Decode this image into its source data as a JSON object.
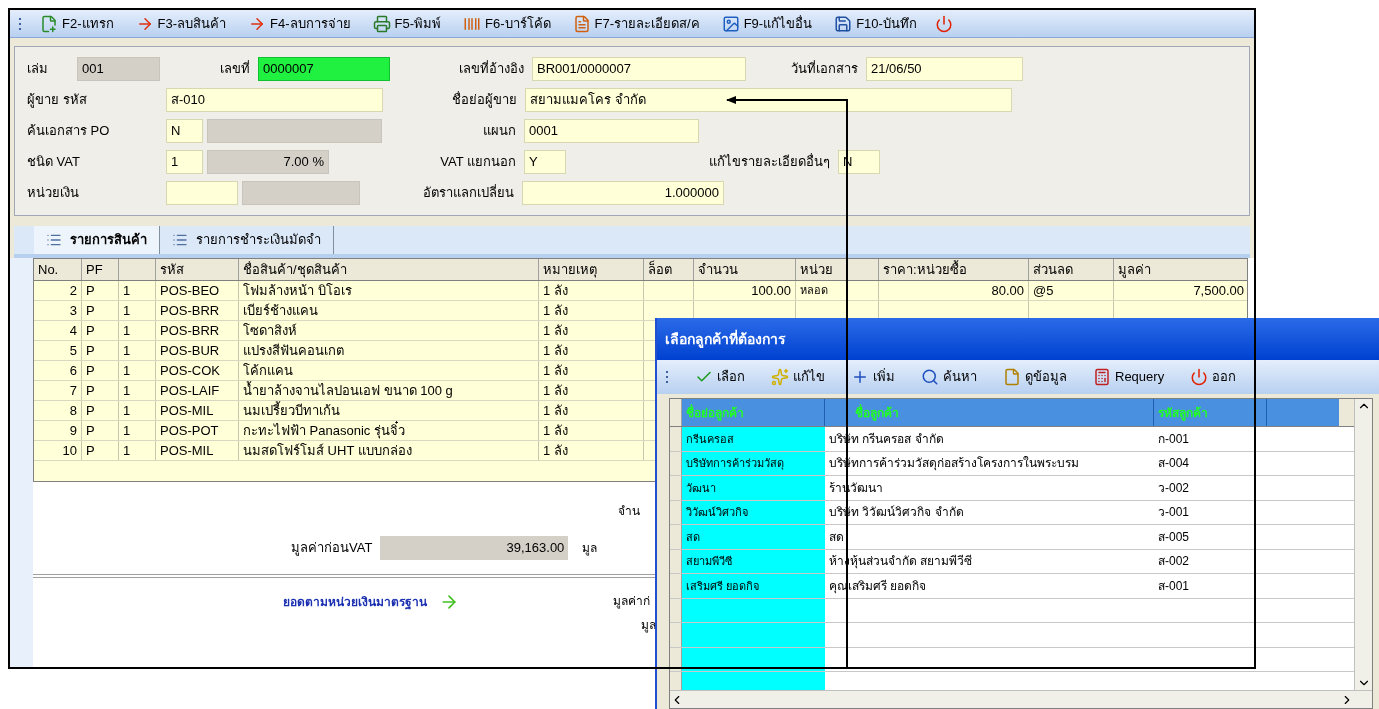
{
  "toolbar": [
    {
      "label": "F2-แทรก"
    },
    {
      "label": "F3-ลบสินค้า"
    },
    {
      "label": "F4-ลบการจ่าย"
    },
    {
      "label": "F5-พิมพ์"
    },
    {
      "label": "F6-บาร์โค้ด"
    },
    {
      "label": "F7-รายละเอียดส/ค"
    },
    {
      "label": "F9-แก้ไขอื่น"
    },
    {
      "label": "F10-บันทึก"
    }
  ],
  "form": {
    "fields": [
      {
        "label": "เล่ม",
        "boxes": [
          {
            "kind": "readonly",
            "text": "001"
          }
        ]
      },
      {
        "label": "เลขที่",
        "boxes": [
          {
            "kind": "highlight",
            "text": "0000007"
          }
        ]
      },
      {
        "label": "เลขที่อ้างอิง",
        "boxes": [
          {
            "kind": "input",
            "text": "BR001/0000007"
          }
        ]
      },
      {
        "label": "วันที่เอกสาร",
        "boxes": [
          {
            "kind": "input",
            "text": "21/06/50"
          }
        ]
      },
      {
        "label": "ผู้ขาย รหัส",
        "boxes": [
          {
            "kind": "input",
            "text": "ส-010"
          }
        ]
      },
      {
        "label": "ชื่อย่อผู้ขาย",
        "boxes": [
          {
            "kind": "input",
            "text": "สยามแมคโคร จำกัด"
          }
        ]
      },
      {
        "label": "ค้นเอกสาร PO",
        "boxes": [
          {
            "kind": "input",
            "text": "N"
          },
          {
            "kind": "readonly"
          }
        ]
      },
      {
        "label": "แผนก",
        "boxes": [
          {
            "kind": "input",
            "text": "0001"
          }
        ]
      },
      {
        "label": "ชนิด VAT",
        "boxes": [
          {
            "kind": "input",
            "text": "1"
          },
          {
            "kind": "readonly",
            "text": "7.00 %"
          }
        ]
      },
      {
        "label": "VAT แยกนอก",
        "boxes": [
          {
            "kind": "input",
            "text": "Y"
          }
        ]
      },
      {
        "label": "แก้ไขรายละเอียดอื่นๆ",
        "boxes": [
          {
            "kind": "input",
            "text": "N"
          }
        ]
      },
      {
        "label": "หน่วยเงิน",
        "boxes": [
          {
            "kind": "input"
          },
          {
            "kind": "readonly"
          }
        ]
      },
      {
        "label": "อัตราแลกเปลี่ยน",
        "boxes": [
          {
            "kind": "input",
            "text": "1.000000"
          }
        ]
      }
    ]
  },
  "tabs": [
    {
      "label": "รายการสินค้า",
      "selected": true
    },
    {
      "label": "รายการชำระเงินมัดจำ",
      "selected": false
    }
  ],
  "table": {
    "columns": [
      {
        "label": "No."
      },
      {
        "label": "PF"
      },
      {},
      {
        "label": "รหัส"
      },
      {
        "label": "ชื่อสินค้า/ชุดสินค้า"
      },
      {
        "label": "หมายเหตุ"
      },
      {
        "label": "ล็อต"
      },
      {
        "label": "จำนวน"
      },
      {
        "label": "หน่วย"
      },
      {
        "label": "ราคา:หน่วยซื้อ"
      },
      {
        "label": "ส่วนลด"
      },
      {
        "label": "มูลค่า"
      }
    ],
    "rows": [
      [
        "2",
        "P",
        "1",
        "POS-BEO",
        "โฟมล้างหน้า บิโอเร",
        "1 ลัง",
        null,
        "100.00",
        "หลอด",
        "80.00",
        "@5",
        "7,500.00"
      ],
      [
        "3",
        "P",
        "1",
        "POS-BRR",
        "เบียร์ช้างแคน",
        "1 ลัง"
      ],
      [
        "4",
        "P",
        "1",
        "POS-BRR",
        "โซดาสิงห์",
        "1 ลัง"
      ],
      [
        "5",
        "P",
        "1",
        "POS-BUR",
        "แปรงสีฟันคอนเกต",
        "1 ลัง"
      ],
      [
        "6",
        "P",
        "1",
        "POS-COK",
        "โค้กแคน",
        "1 ลัง"
      ],
      [
        "7",
        "P",
        "1",
        "POS-LAIF",
        "น้ำยาล้างจานไลปอนเอฟ ขนาด 100 g",
        "1 ลัง"
      ],
      [
        "8",
        "P",
        "1",
        "POS-MIL",
        "นมเปรี้ยวบีทาเก้น",
        "1 ลัง"
      ],
      [
        "9",
        "P",
        "1",
        "POS-POT",
        "กะทะไฟฟ้า  Panasonic  รุ่นจิ๋ว",
        "1 ลัง"
      ],
      [
        "10",
        "P",
        "1",
        "POS-MIL",
        "นมสดโฟร์โมส์ UHT แบบกล่อง",
        "1 ลัง"
      ]
    ]
  },
  "totals": {
    "quantity_label": "จำน",
    "pre_vat_label": "มูลค่าก่อนVAT",
    "pre_vat_value": "39,163.00",
    "column_3_label": "มูล"
  },
  "standard_currency": {
    "label": "ยอดตามหน่วยเงินมาตรฐาน",
    "label_2": "มูลค่าก่",
    "label_3": "มูล"
  },
  "dialog": {
    "title": "เลือกลูกค้าที่ต้องการ",
    "toolbar": [
      {
        "label": "เลือก"
      },
      {
        "label": "แก้ไข"
      },
      {
        "label": "เพิ่ม"
      },
      {
        "label": "ค้นหา"
      },
      {
        "label": "ดูข้อมูล"
      },
      {
        "label": "Requery"
      },
      {
        "label": "ออก"
      }
    ],
    "columns": [
      "ชื่อย่อลูกค้า",
      "ชื่อลูกค้า",
      "รหัสลูกค้า"
    ],
    "rows": [
      [
        "กรีนครอส",
        "บริษัท กรีนครอส จำกัด",
        "ก-001"
      ],
      [
        "บริษัทการค้าร่วมวัสดุ",
        "บริษัทการค้าร่วมวัสดุก่อสร้างโครงการในพระบรม",
        "ส-004"
      ],
      [
        "วัฒนา",
        "ร้านวัฒนา",
        "ว-002"
      ],
      [
        "วิวัฒน์วิศวกิจ",
        "บริษัท วิวัฒน์วิศวกิจ จำกัด",
        "ว-001"
      ],
      [
        "สด",
        "สด",
        "ส-005"
      ],
      [
        "สยามพีวีซี",
        "ห้างหุ้นส่วนจำกัด สยามพีวีซี",
        "ส-002"
      ],
      [
        "เสริมศรี ยอดกิจ",
        "คุณเสริมศรี ยอดกิจ",
        "ส-001"
      ]
    ]
  }
}
